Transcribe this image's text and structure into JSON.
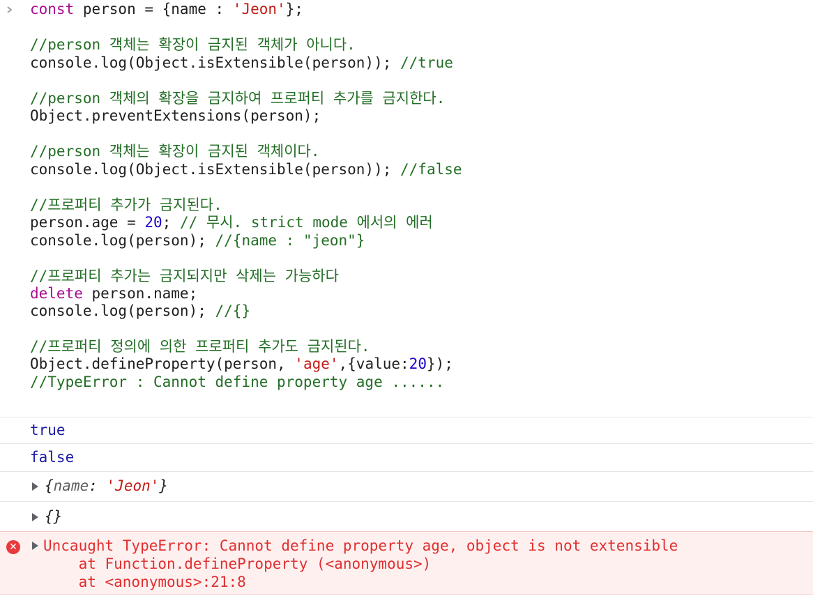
{
  "prompt_icon": "chevron-right-icon",
  "code_lines": [
    {
      "parts": [
        [
          "kw",
          "const"
        ],
        [
          "pl",
          " person = {name : "
        ],
        [
          "str",
          "'Jeon'"
        ],
        [
          "pl",
          "};"
        ]
      ]
    },
    {
      "parts": []
    },
    {
      "parts": [
        [
          "cm",
          "//person 객체는 확장이 금지된 객체가 아니다."
        ]
      ]
    },
    {
      "parts": [
        [
          "pl",
          "console.log(Object.isExtensible(person)); "
        ],
        [
          "cm",
          "//true"
        ]
      ]
    },
    {
      "parts": []
    },
    {
      "parts": [
        [
          "cm",
          "//person 객체의 확장을 금지하여 프로퍼티 추가를 금지한다."
        ]
      ]
    },
    {
      "parts": [
        [
          "pl",
          "Object.preventExtensions(person);"
        ]
      ]
    },
    {
      "parts": []
    },
    {
      "parts": [
        [
          "cm",
          "//person 객체는 확장이 금지된 객체이다."
        ]
      ]
    },
    {
      "parts": [
        [
          "pl",
          "console.log(Object.isExtensible(person)); "
        ],
        [
          "cm",
          "//false"
        ]
      ]
    },
    {
      "parts": []
    },
    {
      "parts": [
        [
          "cm",
          "//프로퍼티 추가가 금지된다."
        ]
      ]
    },
    {
      "parts": [
        [
          "pl",
          "person.age = "
        ],
        [
          "num",
          "20"
        ],
        [
          "pl",
          "; "
        ],
        [
          "cm",
          "// 무시. strict mode 에서의 에러"
        ]
      ]
    },
    {
      "parts": [
        [
          "pl",
          "console.log(person); "
        ],
        [
          "cm",
          "//{name : \"jeon\"}"
        ]
      ]
    },
    {
      "parts": []
    },
    {
      "parts": [
        [
          "cm",
          "//프로퍼티 추가는 금지되지만 삭제는 가능하다"
        ]
      ]
    },
    {
      "parts": [
        [
          "kw",
          "delete"
        ],
        [
          "pl",
          " person.name;"
        ]
      ]
    },
    {
      "parts": [
        [
          "pl",
          "console.log(person); "
        ],
        [
          "cm",
          "//{}"
        ]
      ]
    },
    {
      "parts": []
    },
    {
      "parts": [
        [
          "cm",
          "//프로퍼티 정의에 의한 프로퍼티 추가도 금지된다."
        ]
      ]
    },
    {
      "parts": [
        [
          "pl",
          "Object.defineProperty(person, "
        ],
        [
          "str",
          "'age'"
        ],
        [
          "pl",
          ",{value:"
        ],
        [
          "num",
          "20"
        ],
        [
          "pl",
          "});"
        ]
      ]
    },
    {
      "parts": [
        [
          "cm",
          "//TypeError : Cannot define property age ......"
        ]
      ]
    }
  ],
  "outputs": {
    "out1": "true",
    "out2": "false",
    "obj1": {
      "open": "{",
      "key": "name",
      "colon": ": ",
      "value": "'Jeon'",
      "close": "}"
    },
    "obj2": "{}"
  },
  "error": {
    "icon": "error-x-icon",
    "line1": "Uncaught TypeError: Cannot define property age, object is not extensible",
    "line2": "    at Function.defineProperty (<anonymous>)",
    "line3": "    at <anonymous>:21:8"
  },
  "colors": {
    "comment": "#236e25",
    "keyword": "#aa0d91",
    "string": "#c41a16",
    "number": "#1c00cf",
    "output_value": "#1a1aa6",
    "error_text": "#e02f2f",
    "error_bg": "#fff0f0"
  }
}
